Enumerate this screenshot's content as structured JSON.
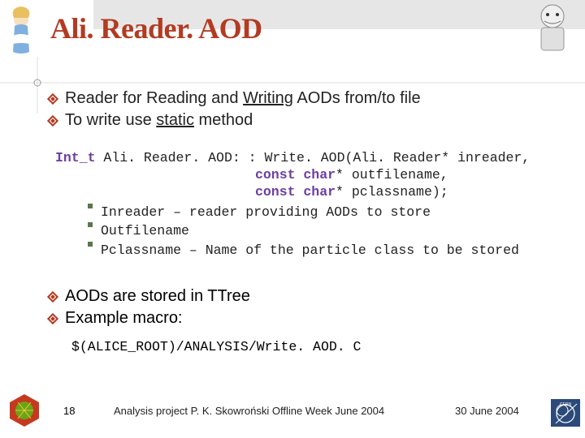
{
  "title": "Ali. Reader. AOD",
  "bullets_top": [
    {
      "pre": "Reader for Reading and ",
      "u": "Writing",
      "post": " AODs from/to file"
    },
    {
      "pre": "To write use ",
      "u": "static",
      "post": " method"
    }
  ],
  "code": {
    "kw": "Int_t",
    "rest1": " Ali. Reader. AOD: : Write. AOD(Ali. Reader* inreader,",
    "kw2a": "const char",
    "rest2": "* outfilename,",
    "kw2b": "const char",
    "rest3": "* pclassname);"
  },
  "sub_bullets": [
    "Inreader – reader providing AODs to store",
    "Outfilename",
    "Pclassname – Name of the particle class to be stored"
  ],
  "bullets_lower": [
    "AODs are stored in TTree",
    "Example macro:"
  ],
  "macro": "$(ALICE_ROOT)/ANALYSIS/Write. AOD. C",
  "footer": {
    "page": "18",
    "center": "Analysis project  P. K. Skowroński   Offline Week June 2004",
    "right": "30 June 2004"
  }
}
